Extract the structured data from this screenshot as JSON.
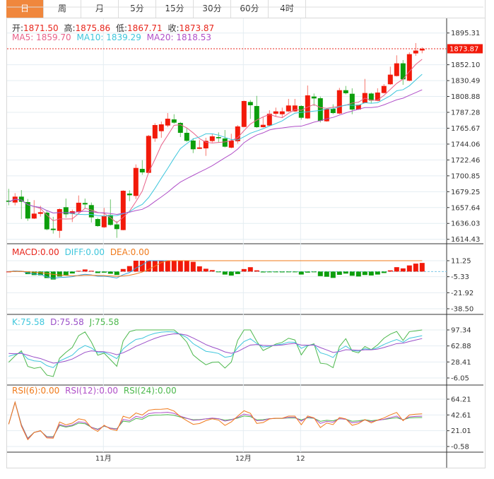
{
  "tabs": [
    "日",
    "周",
    "月",
    "5分",
    "15分",
    "30分",
    "60分",
    "4时"
  ],
  "active_tab": 0,
  "ohlc_legend": {
    "open_label": "开:",
    "open": "1871.50",
    "high_label": "高:",
    "high": "1875.86",
    "low_label": "低:",
    "low": "1867.71",
    "close_label": "收:",
    "close": "1873.87"
  },
  "ma_legend": {
    "ma5": "MA5: 1859.70",
    "ma10": "MA10: 1839.29",
    "ma20": "MA20: 1818.53"
  },
  "macd_legend": {
    "macd": "MACD:0.00",
    "diff": "DIFF:0.00",
    "dea": "DEA:0.00"
  },
  "kdj_legend": {
    "k": "K:75.58",
    "d": "D:75.58",
    "j": "J:75.58"
  },
  "rsi_legend": {
    "rsi6": "RSI(6):0.00",
    "rsi12": "RSI(12):0.00",
    "rsi24": "RSI(24):0.00"
  },
  "last_price": "1873.87",
  "price_ticks": [
    "1895.31",
    "1852.10",
    "1830.49",
    "1808.88",
    "1787.28",
    "1765.67",
    "1744.06",
    "1722.46",
    "1700.85",
    "1679.25",
    "1657.64",
    "1636.03",
    "1614.43"
  ],
  "macd_ticks": [
    "11.25",
    "-5.33",
    "-21.92",
    "-38.50"
  ],
  "kdj_ticks": [
    "97.34",
    "62.88",
    "28.41",
    "-6.05"
  ],
  "rsi_ticks": [
    "64.21",
    "42.61",
    "21.01",
    "-0.58"
  ],
  "x_labels": [
    {
      "label": "11月",
      "index": 15
    },
    {
      "label": "12月",
      "index": 37
    },
    {
      "label": "12",
      "index": 46
    }
  ],
  "colors": {
    "up": "#f21a0a",
    "down": "#0c9e0c",
    "ma5": "#e8628a",
    "ma10": "#3ec6dc",
    "ma20": "#b04fc8",
    "tab_active": "#f0873d"
  },
  "chart_data": {
    "type": "candlestick",
    "price_range": [
      1614.43,
      1895.31
    ],
    "candles": [
      [
        1667.1,
        1683.1,
        1660.7,
        1665.5
      ],
      [
        1664.5,
        1677.3,
        1660.7,
        1672.5
      ],
      [
        1672.5,
        1681.5,
        1642.0,
        1665.5
      ],
      [
        1665.1,
        1669.3,
        1639.5,
        1642.7
      ],
      [
        1642.7,
        1667.7,
        1642.0,
        1649.4
      ],
      [
        1649.1,
        1660.0,
        1645.3,
        1651.3
      ],
      [
        1650.7,
        1653.3,
        1626.7,
        1628.0
      ],
      [
        1628.9,
        1645.0,
        1622.2,
        1627.0
      ],
      [
        1626.0,
        1656.5,
        1616.4,
        1655.5
      ],
      [
        1658.1,
        1669.9,
        1643.7,
        1648.5
      ],
      [
        1649.1,
        1654.9,
        1637.9,
        1652.6
      ],
      [
        1651.7,
        1674.1,
        1650.1,
        1664.2
      ],
      [
        1663.9,
        1669.9,
        1655.9,
        1661.9
      ],
      [
        1661.0,
        1664.5,
        1637.3,
        1644.3
      ],
      [
        1642.0,
        1643.7,
        1631.5,
        1632.4
      ],
      [
        1630.8,
        1657.2,
        1629.9,
        1646.2
      ],
      [
        1647.5,
        1668.7,
        1633.1,
        1634.0
      ],
      [
        1634.7,
        1639.5,
        1616.4,
        1628.3
      ],
      [
        1627.0,
        1681.2,
        1626.7,
        1680.5
      ],
      [
        1676.7,
        1681.2,
        1666.4,
        1674.4
      ],
      [
        1673.5,
        1716.4,
        1669.3,
        1711.6
      ],
      [
        1710.3,
        1722.2,
        1702.3,
        1705.5
      ],
      [
        1704.9,
        1756.5,
        1704.3,
        1755.2
      ],
      [
        1751.7,
        1772.5,
        1747.2,
        1770.0
      ],
      [
        1761.6,
        1774.8,
        1752.7,
        1770.9
      ],
      [
        1769.3,
        1786.3,
        1767.1,
        1778.6
      ],
      [
        1777.7,
        1784.7,
        1771.9,
        1773.2
      ],
      [
        1772.9,
        1774.1,
        1753.6,
        1759.4
      ],
      [
        1759.4,
        1766.1,
        1747.2,
        1748.5
      ],
      [
        1748.8,
        1752.0,
        1731.8,
        1737.0
      ],
      [
        1737.6,
        1749.5,
        1737.3,
        1739.5
      ],
      [
        1738.2,
        1752.7,
        1728.0,
        1748.5
      ],
      [
        1748.2,
        1757.5,
        1746.3,
        1754.6
      ],
      [
        1753.6,
        1760.0,
        1746.3,
        1752.0
      ],
      [
        1751.7,
        1763.2,
        1739.5,
        1740.5
      ],
      [
        1739.2,
        1758.1,
        1738.2,
        1748.8
      ],
      [
        1747.9,
        1770.0,
        1744.7,
        1768.1
      ],
      [
        1767.4,
        1803.3,
        1767.1,
        1802.7
      ],
      [
        1801.4,
        1804.0,
        1778.3,
        1796.9
      ],
      [
        1795.9,
        1809.7,
        1766.1,
        1767.1
      ],
      [
        1767.1,
        1780.9,
        1766.5,
        1770.3
      ],
      [
        1769.3,
        1790.2,
        1768.7,
        1785.4
      ],
      [
        1785.4,
        1793.7,
        1781.5,
        1788.6
      ],
      [
        1784.7,
        1793.7,
        1780.6,
        1788.6
      ],
      [
        1788.6,
        1805.6,
        1787.9,
        1796.6
      ],
      [
        1788.6,
        1805.6,
        1787.9,
        1796.6
      ],
      [
        1795.9,
        1796.9,
        1777.4,
        1779.9
      ],
      [
        1779.0,
        1823.8,
        1778.3,
        1810.4
      ],
      [
        1808.8,
        1812.9,
        1795.9,
        1806.2
      ],
      [
        1806.5,
        1808.8,
        1773.5,
        1775.8
      ],
      [
        1775.1,
        1792.4,
        1774.5,
        1791.8
      ],
      [
        1792.1,
        1798.2,
        1784.7,
        1786.3
      ],
      [
        1785.7,
        1820.6,
        1784.7,
        1817.4
      ],
      [
        1817.4,
        1823.2,
        1811.7,
        1813.3
      ],
      [
        1812.6,
        1820.0,
        1784.7,
        1791.1
      ],
      [
        1791.1,
        1797.6,
        1790.5,
        1797.6
      ],
      [
        1800.1,
        1832.8,
        1799.5,
        1813.6
      ],
      [
        1812.9,
        1814.2,
        1799.2,
        1803.3
      ],
      [
        1803.0,
        1820.0,
        1802.4,
        1814.2
      ],
      [
        1813.6,
        1825.8,
        1812.9,
        1823.2
      ],
      [
        1825.5,
        1849.5,
        1824.8,
        1838.6
      ],
      [
        1836.7,
        1864.9,
        1836.0,
        1854.0
      ],
      [
        1854.0,
        1858.5,
        1824.8,
        1832.2
      ],
      [
        1830.3,
        1869.0,
        1829.6,
        1866.5
      ],
      [
        1867.5,
        1881.6,
        1864.2,
        1871.4
      ],
      [
        1871.5,
        1875.86,
        1867.71,
        1873.87
      ]
    ],
    "macd_range": [
      -38.5,
      11.25
    ],
    "kdj_range": [
      -6.05,
      97.34
    ],
    "rsi_range": [
      -0.58,
      64.21
    ]
  }
}
